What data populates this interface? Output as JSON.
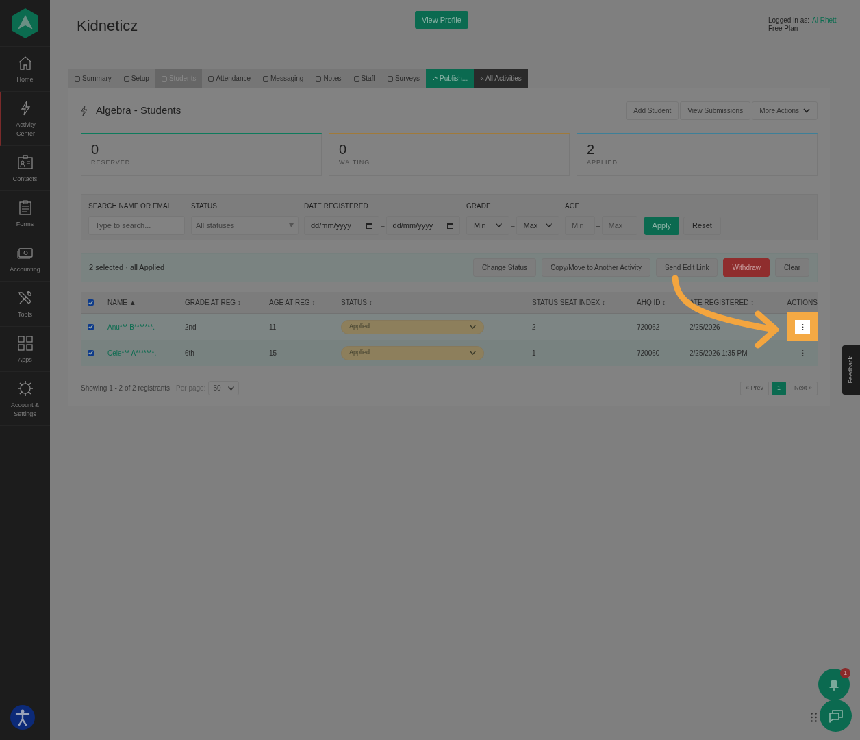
{
  "sidebar": {
    "items": [
      {
        "label": "Home",
        "selected": false
      },
      {
        "label": "Activity Center",
        "selected": true
      },
      {
        "label": "Contacts",
        "selected": false
      },
      {
        "label": "Forms",
        "selected": false
      },
      {
        "label": "Accounting",
        "selected": false
      },
      {
        "label": "Tools",
        "selected": false
      },
      {
        "label": "Apps",
        "selected": false
      },
      {
        "label": "Account & Settings",
        "selected": false
      }
    ]
  },
  "header": {
    "title": "Kidneticz",
    "view_profile": "View Profile",
    "logged_in_label": "Logged in as:",
    "user": "Al Rhett",
    "plan": "Free Plan"
  },
  "tabs": [
    {
      "label": "Summary",
      "kind": "normal",
      "selected": false
    },
    {
      "label": "Setup",
      "kind": "normal",
      "selected": false
    },
    {
      "label": "Students",
      "kind": "normal",
      "selected": true
    },
    {
      "label": "Attendance",
      "kind": "normal",
      "selected": false
    },
    {
      "label": "Messaging",
      "kind": "normal",
      "selected": false
    },
    {
      "label": "Notes",
      "kind": "normal",
      "selected": false
    },
    {
      "label": "Staff",
      "kind": "normal",
      "selected": false
    },
    {
      "label": "Surveys",
      "kind": "normal",
      "selected": false
    },
    {
      "label": "Publish...",
      "kind": "publish",
      "selected": false
    },
    {
      "label": "« All Activities",
      "kind": "back",
      "selected": false
    }
  ],
  "section": {
    "title": "Algebra - Students",
    "buttons": [
      {
        "label": "Add Student",
        "dropdown": false
      },
      {
        "label": "View Submissions",
        "dropdown": false
      },
      {
        "label": "More Actions",
        "dropdown": true
      }
    ]
  },
  "stats": [
    {
      "value": "0",
      "label": "RESERVED",
      "color": "#0e7a5c"
    },
    {
      "value": "0",
      "label": "WAITING",
      "color": "#a07a3a"
    },
    {
      "value": "2",
      "label": "APPLIED",
      "color": "#3d7f98"
    }
  ],
  "filters": {
    "search_label": "SEARCH NAME OR EMAIL",
    "search_placeholder": "Type to search...",
    "status_label": "STATUS",
    "status_placeholder": "All statuses",
    "date_label": "DATE REGISTERED",
    "date_from": "dd/mm/yyyy",
    "date_separator": "–",
    "date_to": "dd/mm/yyyy",
    "grade_separator": "–",
    "age_separator": "–",
    "grade_label": "GRADE",
    "grade_min": "Min",
    "grade_max": "Max",
    "age_label": "AGE",
    "age_min_placeholder": "Min",
    "age_max_placeholder": "Max",
    "apply": "Apply",
    "reset": "Reset"
  },
  "selection": {
    "text": "2 selected · all Applied",
    "buttons": [
      {
        "label": "Change Status",
        "kind": "normal"
      },
      {
        "label": "Copy/Move to Another Activity",
        "kind": "normal"
      },
      {
        "label": "Send Edit Link",
        "kind": "normal"
      },
      {
        "label": "Withdraw",
        "kind": "danger"
      },
      {
        "label": "Clear",
        "kind": "normal"
      }
    ]
  },
  "table": {
    "all_checked": true,
    "columns": [
      "NAME ▲",
      "GRADE AT REG ↕",
      "AGE AT REG ↕",
      "STATUS ↕",
      "STATUS SEAT INDEX ↕",
      "AHQ ID ↕",
      "ATE REGISTERED ↕",
      "ACTIONS"
    ],
    "rows": [
      {
        "checked": true,
        "highlighted": true,
        "name": "Anu*** B*******.",
        "grade": "2nd",
        "age": "11",
        "status": "Applied",
        "seat_index": "2",
        "ahq_id": "720062",
        "date": "2/25/2026"
      },
      {
        "checked": true,
        "highlighted": false,
        "name": "Cele*** A*******.",
        "grade": "6th",
        "age": "15",
        "status": "Applied",
        "seat_index": "1",
        "ahq_id": "720060",
        "date": "2/25/2026 1:35 PM"
      }
    ]
  },
  "footer": {
    "showing": "Showing 1 - 2 of 2 registrants",
    "per_page_label": "Per page:",
    "per_page": "50",
    "pages": [
      {
        "label": "« Prev",
        "selected": false
      },
      {
        "label": "1",
        "selected": true
      },
      {
        "label": "Next »",
        "selected": false
      }
    ]
  },
  "feedback": "Feedback",
  "notifications": {
    "count": "1"
  }
}
